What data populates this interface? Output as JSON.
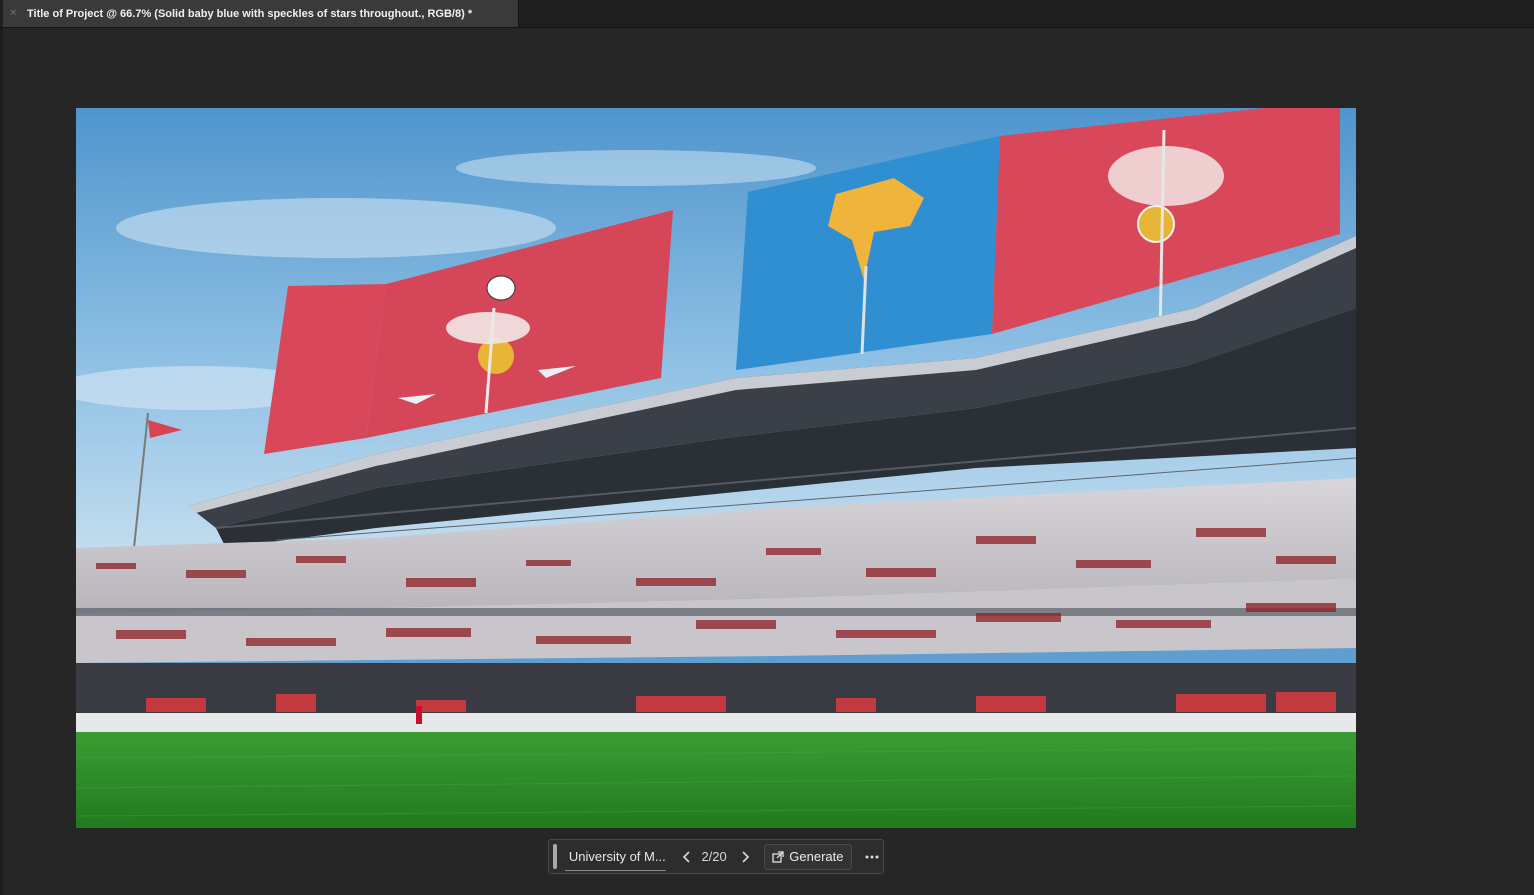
{
  "document_tab": {
    "title": "Title of Project @ 66.7% (Solid baby blue with speckles of stars throughout., RGB/8) *",
    "close_icon": "close-icon"
  },
  "canvas": {
    "image_description_icon": "generated-stadium-image"
  },
  "contextual_taskbar": {
    "prompt_value": "University of M...",
    "prev_icon": "chevron-left-icon",
    "next_icon": "chevron-right-icon",
    "counter": "2/20",
    "generate_label": "Generate",
    "generate_icon": "external-generate-icon",
    "more_icon": "more-options-icon"
  },
  "colors": {
    "workspace_bg": "#262626",
    "tab_bg": "#3a3a3a",
    "banner_red": "#d9475a",
    "banner_blue": "#2f8fd0",
    "grass": "#2f8f2a"
  }
}
